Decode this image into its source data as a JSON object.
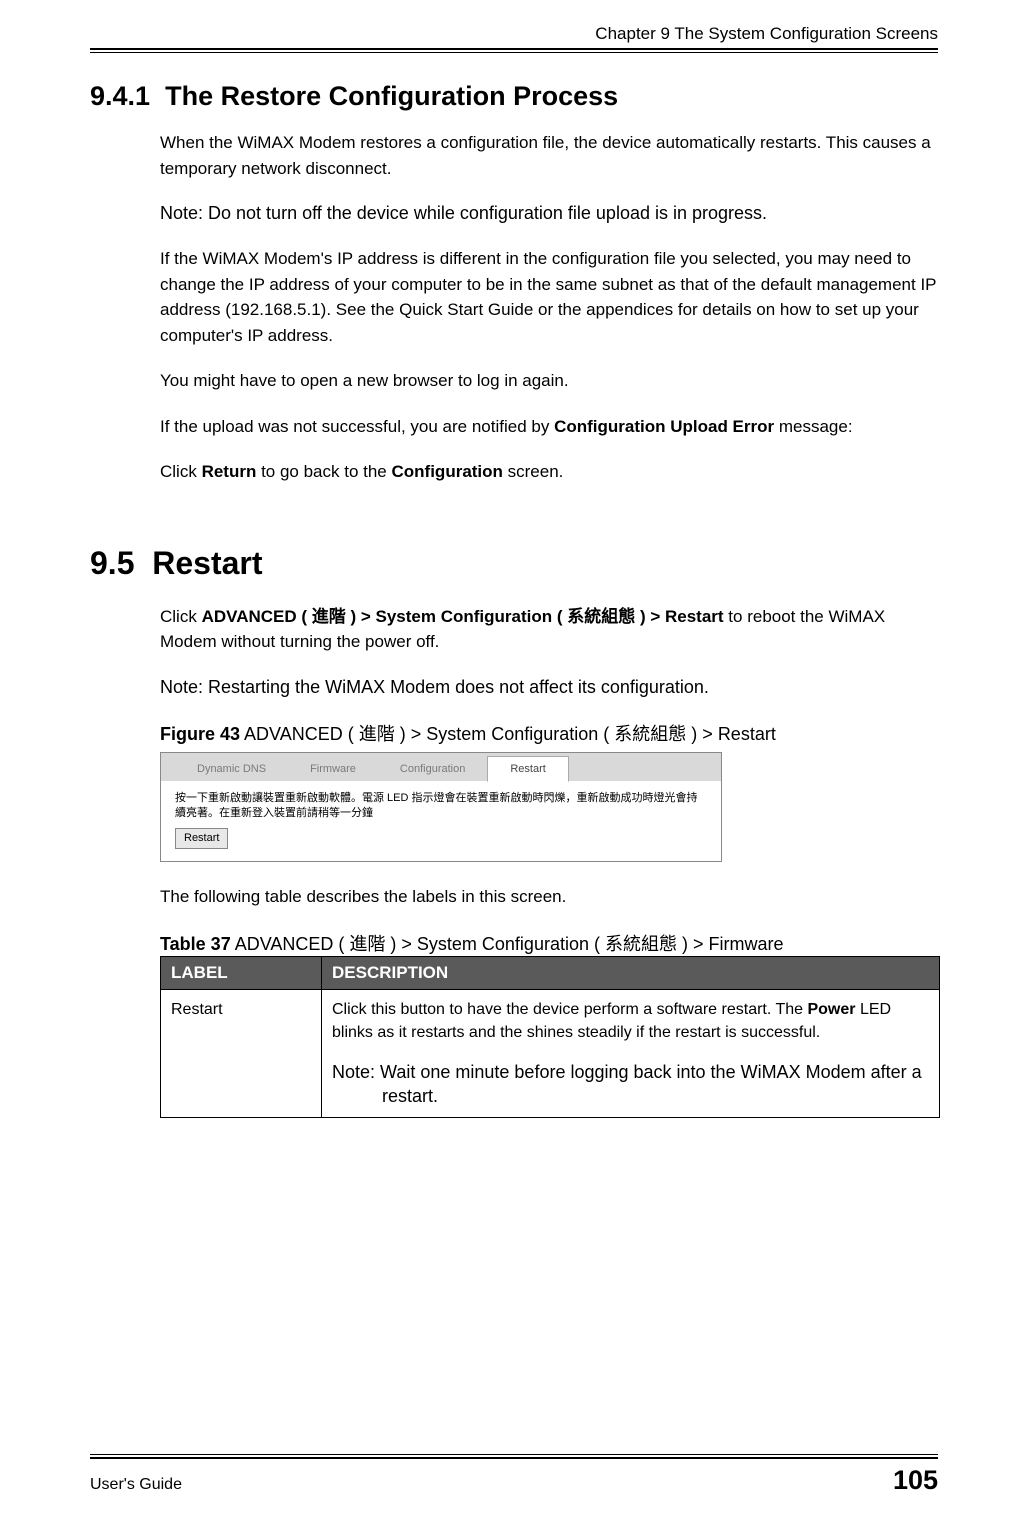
{
  "header": {
    "chapter_line": "Chapter 9 The System Configuration Screens"
  },
  "section_941": {
    "number": "9.4.1",
    "title": "The Restore Configuration Process",
    "paragraphs": {
      "p1": "When the WiMAX Modem restores a configuration file, the device automatically restarts. This causes a temporary network disconnect.",
      "note": "Note: Do not turn off the device while configuration file upload is in progress.",
      "p2": "If the WiMAX Modem's IP address is different in the configuration file you selected, you may need to change the IP address of your computer to be in the same subnet as that of the default management IP address (192.168.5.1). See the Quick Start Guide or the appendices for details on how to set up your computer's IP address.",
      "p3": "You might have to open a new browser to log in again.",
      "p4_pre": "If the upload was not successful, you are notified by ",
      "p4_bold": "Configuration Upload Error",
      "p4_post": " message:",
      "p5_pre": "Click ",
      "p5_b1": "Return",
      "p5_mid": " to go back to the ",
      "p5_b2": "Configuration",
      "p5_post": " screen."
    }
  },
  "section_95": {
    "number": "9.5",
    "title": "Restart",
    "p1_pre": "Click ",
    "p1_b1": "ADVANCED ( 進階 ) > System Configuration ( 系統組態 ) > Restart",
    "p1_post": " to reboot the WiMAX Modem without turning the power off.",
    "note": "Note: Restarting the WiMAX Modem does not affect its configuration.",
    "figure": {
      "label": "Figure 43",
      "caption": "   ADVANCED ( 進階 ) > System Configuration ( 系統組態 ) > Restart"
    },
    "screenshot": {
      "tabs": [
        "Dynamic DNS",
        "Firmware",
        "Configuration",
        "Restart"
      ],
      "active_tab": "Restart",
      "body_text": "按一下重新啟動讓裝置重新啟動軟體。電源 LED 指示燈會在裝置重新啟動時閃爍，重新啟動成功時燈光會持續亮著。在重新登入裝置前請稍等一分鐘",
      "button": "Restart"
    },
    "table_intro": "The following table describes the labels in this screen.",
    "table": {
      "label": "Table 37",
      "caption": "   ADVANCED ( 進階 ) > System Configuration ( 系統組態 ) > Firmware",
      "headers": {
        "c1": "LABEL",
        "c2": "DESCRIPTION"
      },
      "rows": [
        {
          "label": "Restart",
          "desc_pre": "Click this button to have the device perform a software restart. The ",
          "desc_bold": "Power",
          "desc_post": " LED blinks as it restarts and the shines steadily if the restart is successful.",
          "note": "Note: Wait one minute before logging back into the WiMAX Modem after a restart."
        }
      ]
    }
  },
  "footer": {
    "left": "User's Guide",
    "right": "105"
  }
}
